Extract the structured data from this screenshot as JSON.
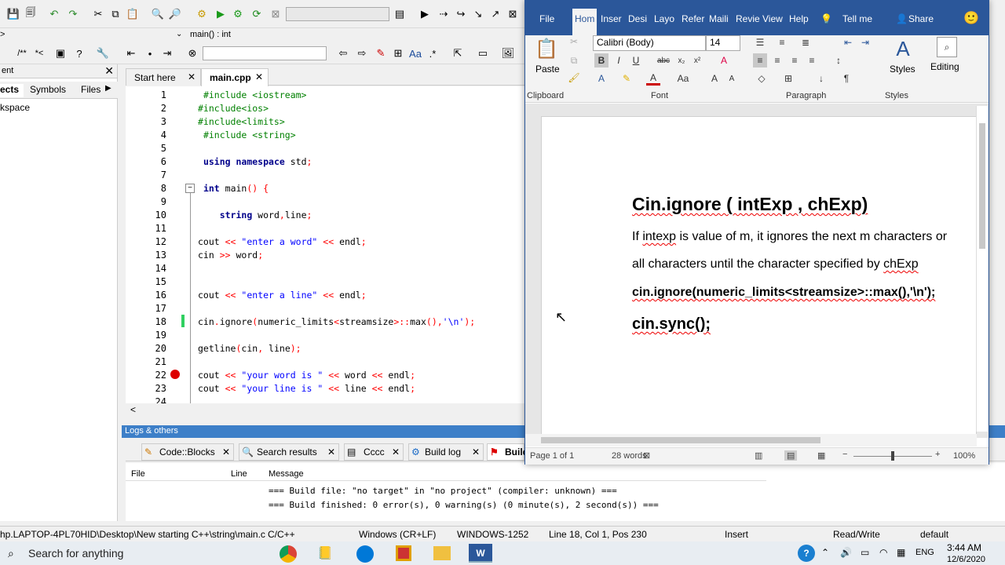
{
  "cb": {
    "scope_combo": "main() : int",
    "mgmt_header": "ent",
    "mgmt_tabs": [
      "ects",
      "Symbols",
      "Files"
    ],
    "workspace": "kspace",
    "editor_tabs": [
      "Start here",
      "main.cpp"
    ],
    "code_lines": [
      {
        "n": "1",
        "html": " <span class='pp'>#include &lt;iostream&gt;</span>"
      },
      {
        "n": "2",
        "html": "<span class='pp'>#include&lt;ios&gt;</span>"
      },
      {
        "n": "3",
        "html": "<span class='pp'>#include&lt;limits&gt;</span>"
      },
      {
        "n": "4",
        "html": " <span class='pp'>#include &lt;string&gt;</span>"
      },
      {
        "n": "5",
        "html": ""
      },
      {
        "n": "6",
        "html": " <span class='kw'>using namespace</span> std<span class='op'>;</span>"
      },
      {
        "n": "7",
        "html": ""
      },
      {
        "n": "8",
        "html": " <span class='kw'>int</span> main<span class='op'>()</span> <span class='op'>{</span>"
      },
      {
        "n": "9",
        "html": ""
      },
      {
        "n": "10",
        "html": "    <span class='kw'>string</span> word<span class='op'>,</span>line<span class='op'>;</span>"
      },
      {
        "n": "11",
        "html": ""
      },
      {
        "n": "12",
        "html": "cout <span class='op'>&lt;&lt;</span> <span class='str'>\"enter a word\"</span> <span class='op'>&lt;&lt;</span> endl<span class='op'>;</span>"
      },
      {
        "n": "13",
        "html": "cin <span class='op'>&gt;&gt;</span> word<span class='op'>;</span>"
      },
      {
        "n": "14",
        "html": ""
      },
      {
        "n": "15",
        "html": ""
      },
      {
        "n": "16",
        "html": "cout <span class='op'>&lt;&lt;</span> <span class='str'>\"enter a line\"</span> <span class='op'>&lt;&lt;</span> endl<span class='op'>;</span>"
      },
      {
        "n": "17",
        "html": ""
      },
      {
        "n": "18",
        "html": "cin<span class='op'>.</span>ignore<span class='op'>(</span>numeric_limits<span class='op'>&lt;</span>streamsize<span class='op'>&gt;::</span>max<span class='op'>(),</span><span class='str'>'\\n'</span><span class='op'>);</span>"
      },
      {
        "n": "19",
        "html": ""
      },
      {
        "n": "20",
        "html": "getline<span class='op'>(</span>cin<span class='op'>,</span> line<span class='op'>);</span>"
      },
      {
        "n": "21",
        "html": ""
      },
      {
        "n": "22",
        "html": "cout <span class='op'>&lt;&lt;</span> <span class='str'>\"your word is \"</span> <span class='op'>&lt;&lt;</span> word <span class='op'>&lt;&lt;</span> endl<span class='op'>;</span>"
      },
      {
        "n": "23",
        "html": "cout <span class='op'>&lt;&lt;</span> <span class='str'>\"your line is \"</span> <span class='op'>&lt;&lt;</span> line <span class='op'>&lt;&lt;</span> endl<span class='op'>;</span>"
      },
      {
        "n": "24",
        "html": ""
      }
    ],
    "logs_title": "Logs & others",
    "log_tabs": [
      "Code::Blocks",
      "Search results",
      "Cccc",
      "Build log",
      "Build"
    ],
    "log_cols": [
      "File",
      "Line",
      "Message"
    ],
    "log_msgs": [
      "=== Build file: \"no target\" in \"no project\" (compiler: unknown) ===",
      "=== Build finished: 0 error(s), 0 warning(s) (0 minute(s), 2 second(s)) ==="
    ],
    "status": {
      "path": "hp.LAPTOP-4PL70HID\\Desktop\\New starting C++\\string\\main.c",
      "lang": "C/C++",
      "eol": "Windows (CR+LF)",
      "enc": "WINDOWS-1252",
      "pos": "Line 18, Col 1, Pos 230",
      "mode": "Insert",
      "rw": "Read/Write",
      "prof": "default"
    }
  },
  "word": {
    "tabs": [
      "File",
      "Hom",
      "Inser",
      "Desi",
      "Layo",
      "Refer",
      "Maili",
      "Revie",
      "View",
      "Help"
    ],
    "tell_me": "Tell me",
    "share": "Share",
    "paste": "Paste",
    "font_name": "Calibri (Body)",
    "font_size": "14",
    "styles": "Styles",
    "editing": "Editing",
    "groups": [
      "Clipboard",
      "Font",
      "Paragraph",
      "Styles"
    ],
    "doc": {
      "heading": "Cin.ignore ( intExp , chExp)",
      "para1_a": "If ",
      "para1_b": "intexp",
      "para1_c": " is value of m, it ignores the next m characters or",
      "para2_a": "all characters until the character specified by ",
      "para2_b": "chExp",
      "code1": "cin.ignore(numeric_limits<streamsize>::max(),'\\n');",
      "code2": "cin.sync();"
    },
    "status": {
      "page": "Page 1 of 1",
      "words": "28 words",
      "zoom": "100%"
    }
  },
  "taskbar": {
    "search": "Search for anything",
    "time": "3:44 AM",
    "date": "12/6/2020",
    "lang": "ENG"
  }
}
